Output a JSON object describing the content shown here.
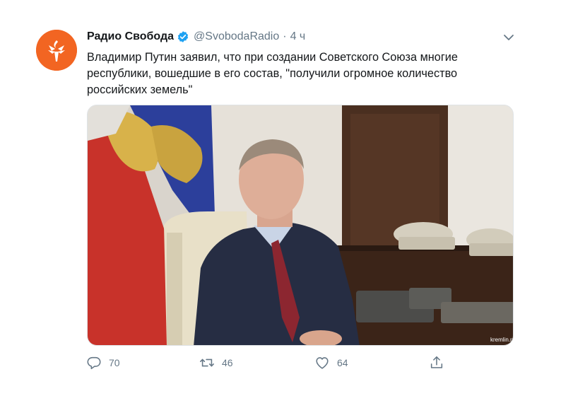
{
  "tweet": {
    "author_name": "Радио Свобода",
    "handle": "@SvobodaRadio",
    "separator": "·",
    "time": "4 ч",
    "text": "Владимир Путин  заявил, что при создании Советского Союза многие республики, вошедшие в его состав, \"получили огромное количество российских земель\"",
    "media_watermark": "kremlin.ru",
    "icons": {
      "avatar": "torch-logo-icon",
      "verified": "verified-badge-icon",
      "menu": "chevron-down-icon",
      "reply": "reply-icon",
      "retweet": "retweet-icon",
      "like": "heart-icon",
      "share": "share-icon"
    },
    "colors": {
      "brand": "#f26522",
      "verified": "#1da1f2",
      "muted": "#657786"
    }
  },
  "actions": {
    "replies": "70",
    "retweets": "46",
    "likes": "64"
  }
}
